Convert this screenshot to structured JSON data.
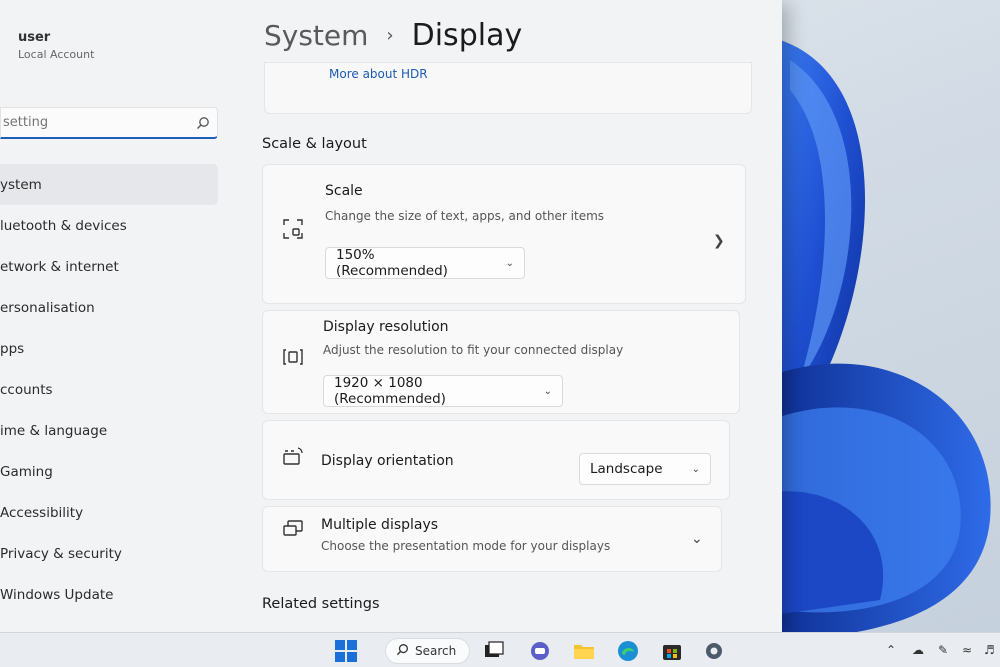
{
  "account": {
    "name": "user",
    "type": "Local Account"
  },
  "search": {
    "placeholder": "setting"
  },
  "sidebar": {
    "items": [
      {
        "label": "ystem",
        "selected": true
      },
      {
        "label": "luetooth & devices"
      },
      {
        "label": "etwork & internet"
      },
      {
        "label": "ersonalisation"
      },
      {
        "label": "pps"
      },
      {
        "label": "ccounts"
      },
      {
        "label": "ime & language"
      },
      {
        "label": "Gaming"
      },
      {
        "label": "Accessibility"
      },
      {
        "label": "Privacy & security"
      },
      {
        "label": "Windows Update"
      }
    ]
  },
  "breadcrumb": {
    "parent": "System",
    "separator": "›",
    "current": "Display"
  },
  "hdr": {
    "link": "More about HDR"
  },
  "scale_layout": {
    "title": "Scale & layout",
    "scale": {
      "title": "Scale",
      "desc": "Change the size of text, apps, and other items",
      "value": "150% (Recommended)"
    },
    "resolution": {
      "title": "Display resolution",
      "desc": "Adjust the resolution to fit your connected display",
      "value": "1920 × 1080 (Recommended)"
    },
    "orientation": {
      "title": "Display orientation",
      "value": "Landscape"
    },
    "multiple": {
      "title": "Multiple displays",
      "desc": "Choose the presentation mode for your displays"
    }
  },
  "related": {
    "title": "Related settings"
  },
  "taskbar": {
    "search_label": "Search"
  },
  "colors": {
    "accent": "#1d5fb8",
    "wallpaper_bloom": "#1f4fd1"
  }
}
